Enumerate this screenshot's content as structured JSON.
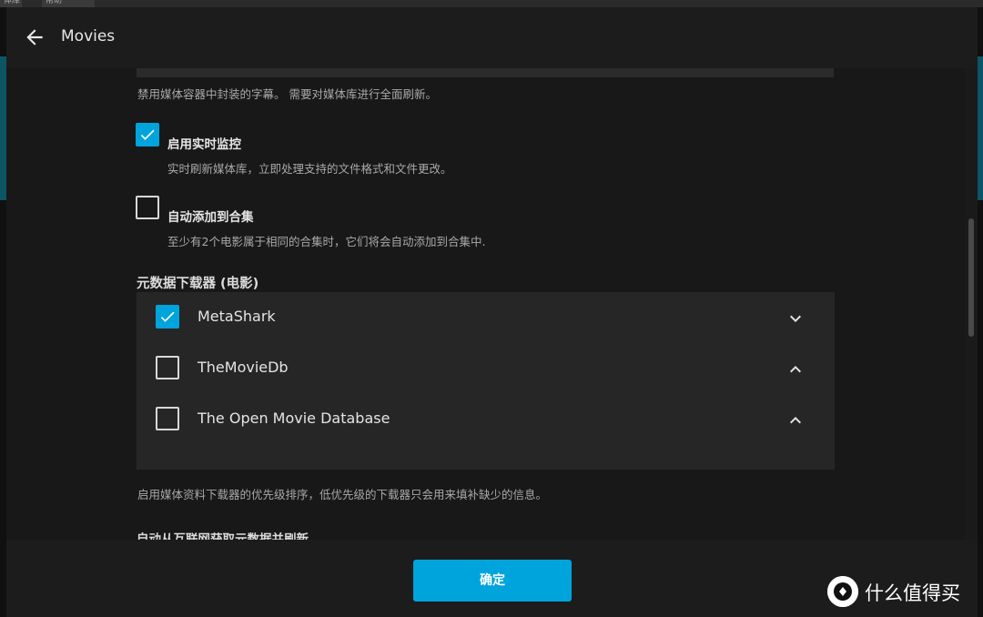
{
  "background": {
    "tabs": [
      "体库",
      "帮助"
    ]
  },
  "dialog": {
    "title": "Movies",
    "back_icon": "arrow-left-icon"
  },
  "settings": {
    "embedded_subs_help": "禁用媒体容器中封装的字幕。 需要对媒体库进行全面刷新。",
    "realtime_monitor": {
      "label": "启用实时监控",
      "help": "实时刷新媒体库，立即处理支持的文件格式和文件更改。",
      "checked": true
    },
    "auto_collection": {
      "label": "自动添加到合集",
      "help": "至少有2个电影属于相同的合集时，它们将会自动添加到合集中.",
      "checked": false
    },
    "metadata_fetchers": {
      "heading": "元数据下载器 (电影)",
      "items": [
        {
          "name": "MetaShark",
          "checked": true,
          "chevron": "chevron-down-icon"
        },
        {
          "name": "TheMovieDb",
          "checked": false,
          "chevron": "chevron-up-icon"
        },
        {
          "name": "The Open Movie Database",
          "checked": false,
          "chevron": "chevron-up-icon"
        }
      ],
      "help": "启用媒体资料下载器的优先级排序，低优先级的下载器只会用来填补缺少的信息。"
    },
    "auto_refresh_heading": "自动从互联网获取元数据并刷新"
  },
  "footer": {
    "ok_label": "确定"
  },
  "watermark": {
    "logo_char": "值",
    "text": "什么值得买"
  },
  "colors": {
    "accent": "#00a4dc",
    "dialog_bg": "#1c1c1c",
    "list_bg": "#262626"
  }
}
